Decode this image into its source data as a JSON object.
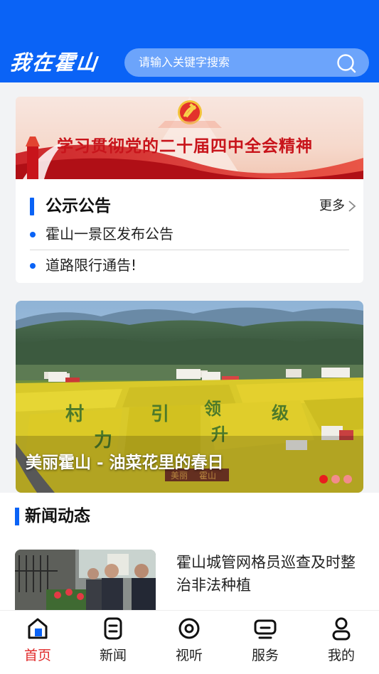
{
  "header": {
    "app_title": "我在霍山",
    "search_placeholder": "请输入关键字搜索",
    "search_icon": "search-icon",
    "bg_color": "#0a63f6"
  },
  "banner": {
    "text": "学习贯彻党的二十届四中全会精神",
    "emblem_icon": "party-emblem-icon"
  },
  "notice": {
    "title": "公示公告",
    "more_label": "更多",
    "items": [
      {
        "label": "霍山一景区发布公告"
      },
      {
        "label": "道路限行通告!"
      }
    ]
  },
  "featured": {
    "caption": "美丽霍山 - 油菜花里的春日",
    "field_words": [
      "村",
      "引",
      "领",
      "升",
      "级",
      "力"
    ],
    "signage": [
      "美丽",
      "霍山"
    ],
    "carousel": {
      "count": 3,
      "active_index": 0
    }
  },
  "news": {
    "section_title": "新闻动态",
    "articles": [
      {
        "headline": "霍山城管网格员巡查及时整治非法种植"
      }
    ]
  },
  "tabbar": {
    "active_color": "#e02a2a",
    "tabs": [
      {
        "label": "首页",
        "icon": "home-icon",
        "active": true
      },
      {
        "label": "新闻",
        "icon": "news-icon",
        "active": false
      },
      {
        "label": "视听",
        "icon": "media-icon",
        "active": false
      },
      {
        "label": "服务",
        "icon": "service-icon",
        "active": false
      },
      {
        "label": "我的",
        "icon": "profile-icon",
        "active": false
      }
    ]
  }
}
